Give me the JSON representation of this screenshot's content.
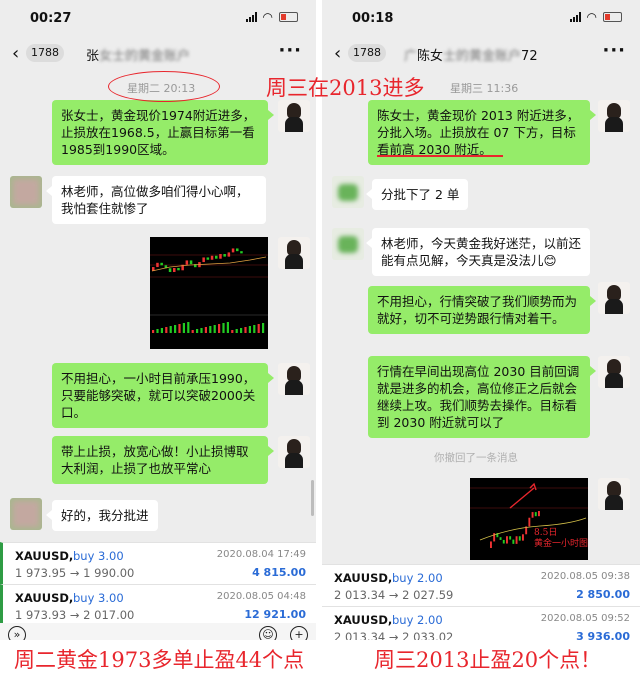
{
  "left": {
    "status_time": "00:27",
    "unread": "1788",
    "contact": "张",
    "contact_blurred": "女士的黄金账户",
    "timestamp": "星期二 20:13",
    "messages": [
      "张女士，黄金现价1974附近进多，止损放在1968.5，止赢目标第一看1985到1990区域。",
      "林老师，高位做多咱们得小心啊，我怕套住就惨了",
      "不用担心，一小时目前承压1990，只要能够突破，就可以突破2000关口。",
      "带上止损，放宽心做！小止损博取大利润，止损了也放平常心",
      "好的，我分批进"
    ],
    "trades": [
      {
        "symbol": "XAUUSD,",
        "direction": "buy 3.00",
        "datetime": "2020.08.04 17:49",
        "prices": "1 973.95 → 1 990.00",
        "profit": "4 815.00"
      },
      {
        "symbol": "XAUUSD,",
        "direction": "buy 3.00",
        "datetime": "2020.08.05 04:48",
        "prices": "1 973.93 → 2 017.00",
        "profit": "12 921.00"
      }
    ],
    "caption": "周二黄金1973多单止盈44个点"
  },
  "right": {
    "status_time": "00:18",
    "unread": "1788",
    "contact": "陈女",
    "contact_prefix_blurred": "广",
    "contact_blurred": "士的黄金账户",
    "contact_suffix": "72",
    "timestamp": "星期三 11:36",
    "messages": [
      "陈女士，黄金现价 2013 附近进多，分批入场。止损放在 07 下方，目标看前高 2030 附近。",
      "分批下了 2 单",
      "林老师，今天黄金我好迷茫，以前还能有点见解，今天真是没法儿",
      "不用担心，行情突破了我们顺势而为就好，切不可逆势跟行情对着干。",
      "行情在早间出现高位 2030 目前回调就是进多的机会，高位修正之后就会继续上攻。我们顺势去操作。目标看到 2030 附近就可以了"
    ],
    "emoji": "😊",
    "withdrawn": "你撤回了一条消息",
    "chart_annotation_line1": "8.5日",
    "chart_annotation_line2": "黄金一小时图",
    "trades": [
      {
        "symbol": "XAUUSD,",
        "direction": "buy 2.00",
        "datetime": "2020.08.05 09:38",
        "prices": "2 013.34 → 2 027.59",
        "profit": "2 850.00"
      },
      {
        "symbol": "XAUUSD,",
        "direction": "buy 2.00",
        "datetime": "2020.08.05 09:52",
        "prices": "2 013.34 → 2 033.02",
        "profit": "3 936.00"
      }
    ],
    "caption": "周三2013止盈20个点！"
  },
  "overlay_title": "周三在2013进多",
  "colors": {
    "sent_bubble": "#95ec69",
    "received_bubble": "#ffffff",
    "chat_bg": "#ededed",
    "annotation_red": "#e8262d",
    "buy_blue": "#2a6bd6"
  }
}
